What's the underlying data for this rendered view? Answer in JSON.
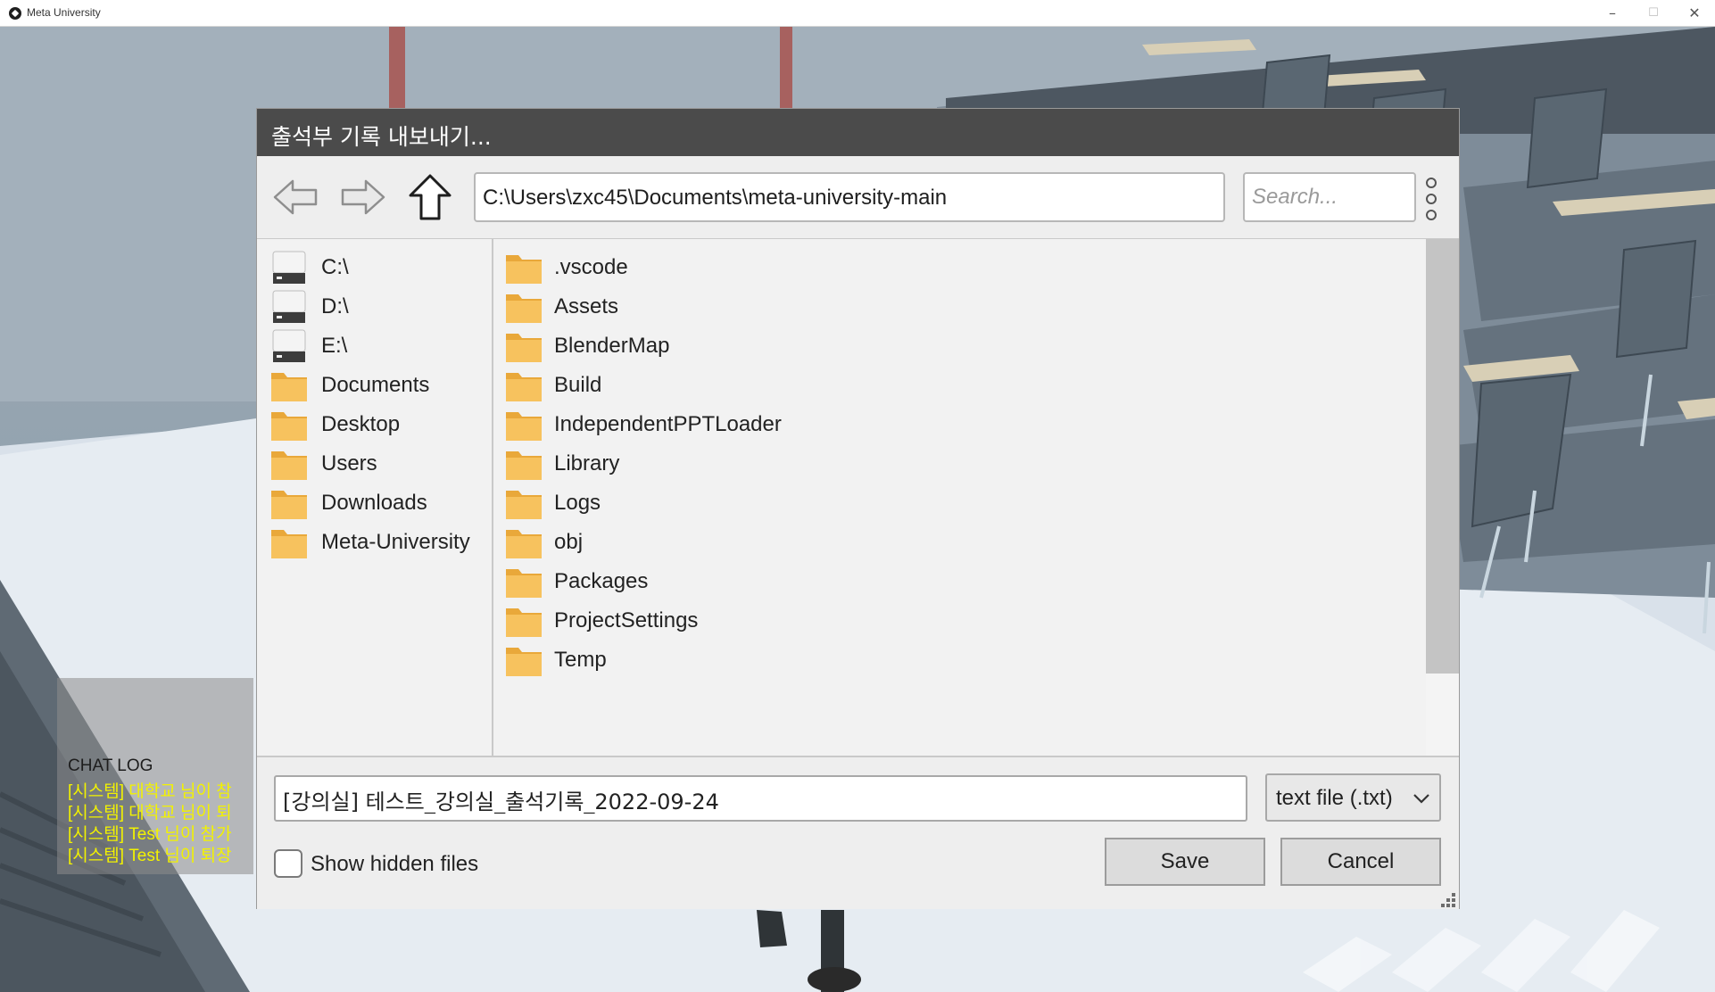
{
  "window": {
    "title": "Meta University",
    "minimize_glyph": "–",
    "maximize_glyph": "☐",
    "close_glyph": "✕"
  },
  "chat_log": {
    "title": "CHAT LOG",
    "lines": [
      "[시스템] 대학교 님이 참",
      "[시스템] 대학교 님이 퇴",
      "[시스템] Test 님이 참가",
      "[시스템] Test 님이 퇴장"
    ],
    "text_color": "#f2f200"
  },
  "dialog": {
    "title": "출석부 기록 내보내기...",
    "path": "C:\\Users\\zxc45\\Documents\\meta-university-main",
    "search_placeholder": "Search...",
    "sidebar_items": [
      {
        "label": "C:\\",
        "icon": "drive-icon"
      },
      {
        "label": "D:\\",
        "icon": "drive-icon"
      },
      {
        "label": "E:\\",
        "icon": "drive-icon"
      },
      {
        "label": "Documents",
        "icon": "folder-icon"
      },
      {
        "label": "Desktop",
        "icon": "folder-icon"
      },
      {
        "label": "Users",
        "icon": "folder-icon"
      },
      {
        "label": "Downloads",
        "icon": "folder-icon"
      },
      {
        "label": "Meta-University",
        "icon": "folder-icon"
      }
    ],
    "files": [
      {
        "label": ".vscode",
        "icon": "folder-icon"
      },
      {
        "label": "Assets",
        "icon": "folder-icon"
      },
      {
        "label": "BlenderMap",
        "icon": "folder-icon"
      },
      {
        "label": "Build",
        "icon": "folder-icon"
      },
      {
        "label": "IndependentPPTLoader",
        "icon": "folder-icon"
      },
      {
        "label": "Library",
        "icon": "folder-icon"
      },
      {
        "label": "Logs",
        "icon": "folder-icon"
      },
      {
        "label": "obj",
        "icon": "folder-icon"
      },
      {
        "label": "Packages",
        "icon": "folder-icon"
      },
      {
        "label": "ProjectSettings",
        "icon": "folder-icon"
      },
      {
        "label": "Temp",
        "icon": "folder-icon"
      }
    ],
    "filename": "[강의실] 테스트_강의실_출석기록_2022-09-24",
    "filetype": "text file (.txt)",
    "show_hidden_label": "Show hidden files",
    "show_hidden_checked": false,
    "save_label": "Save",
    "cancel_label": "Cancel"
  },
  "colors": {
    "dialog_header": "#4b4b4b",
    "folder": "#f5b94a",
    "dialog_bg": "#f0f0f0"
  }
}
